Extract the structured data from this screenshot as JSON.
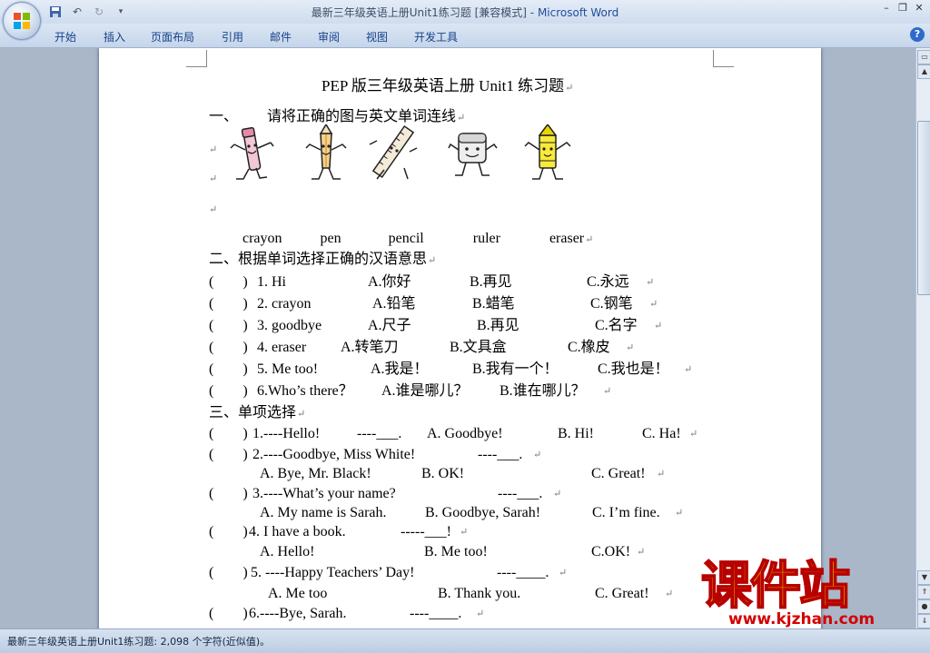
{
  "window": {
    "title": "最新三年级英语上册Unit1练习题 [兼容模式] - ",
    "app_name": "Microsoft Word"
  },
  "ribbon": {
    "tabs": [
      "开始",
      "插入",
      "页面布局",
      "引用",
      "邮件",
      "审阅",
      "视图",
      "开发工具"
    ]
  },
  "icons": [
    "office-button-icon",
    "save-icon",
    "undo-icon",
    "redo-icon",
    "customize-qat-icon",
    "minimize-icon",
    "restore-icon",
    "close-icon",
    "help-icon",
    "scroll-up-icon",
    "ruler-toggle-icon",
    "scroll-down-icon",
    "prev-page-icon",
    "select-browse-icon",
    "next-page-icon"
  ],
  "document": {
    "title": "PEP 版三年级英语上册 Unit1 练习题",
    "section1": {
      "heading_num": "一、",
      "heading": "请将正确的图与英文单词连线",
      "pictures": [
        "pen",
        "pencil",
        "ruler",
        "eraser",
        "crayon"
      ],
      "words": [
        "crayon",
        "pen",
        "pencil",
        "ruler",
        "eraser"
      ]
    },
    "section2": {
      "heading": "二、根据单词选择正确的汉语意思",
      "rows": [
        {
          "paren": "(",
          "paren_close": ")",
          "q": "1. Hi",
          "a": "A.你好",
          "b": "B.再见",
          "c": "C.永远"
        },
        {
          "paren": "(",
          "paren_close": ")",
          "q": "2. crayon",
          "a": "A.铅笔",
          "b": "B.蜡笔",
          "c": "C.钢笔"
        },
        {
          "paren": "(",
          "paren_close": ")",
          "q": "3. goodbye",
          "a": "A.尺子",
          "b": "B.再见",
          "c": "C.名字"
        },
        {
          "paren": "(",
          "paren_close": ")",
          "q": "4. eraser",
          "a": "A.转笔刀",
          "b": "B.文具盒",
          "c": "C.橡皮"
        },
        {
          "paren": "(",
          "paren_close": ")",
          "q": "5. Me too!",
          "a": "A.我是！",
          "b": "B.我有一个！",
          "c": "C.我也是！"
        },
        {
          "paren": "(",
          "paren_close": ")",
          "q": "6.Who’s there？",
          "a": "A.谁是哪儿？",
          "b": "B.谁在哪儿？",
          "c": ""
        }
      ]
    },
    "section3": {
      "heading": "三、单项选择",
      "items": [
        {
          "paren": "(",
          "paren_close": ")",
          "q": "1.----Hello!",
          "reply": "----___.",
          "a": "A. Goodbye!",
          "b": "B. Hi!",
          "c": "C. Ha!"
        },
        {
          "paren": "(",
          "paren_close": ")",
          "q": "2.----Goodbye, Miss White!",
          "reply": "----___.",
          "a": "A. Bye, Mr. Black!",
          "b": "B. OK!",
          "c": "C. Great!"
        },
        {
          "paren": "(",
          "paren_close": ")",
          "q": "3.----What’s your name?",
          "reply": "----___.",
          "a": "A. My name is Sarah.",
          "b": "B. Goodbye, Sarah!",
          "c": "C. I’m fine."
        },
        {
          "paren": "(",
          "paren_close": ")",
          "q": "4. I have a book.",
          "reply": "-----___!",
          "a": "A. Hello!",
          "b": "B. Me too!",
          "c": "C.OK!"
        },
        {
          "paren": "(",
          "paren_close": ")",
          "q": "5. ----Happy Teachers’ Day!",
          "reply": "----____.",
          "a": "A. Me too",
          "b": "B. Thank you.",
          "c": "C. Great!"
        },
        {
          "paren": "(",
          "paren_close": ")",
          "q": "6.----Bye, Sarah.",
          "reply": "----____.",
          "a": "",
          "b": "",
          "c": ""
        }
      ]
    }
  },
  "status_bar": {
    "text": "最新三年级英语上册Unit1练习题: 2,098 个字符(近似值)。"
  },
  "watermark": {
    "brand": "课件站",
    "url": "www.kjzhan.com"
  }
}
